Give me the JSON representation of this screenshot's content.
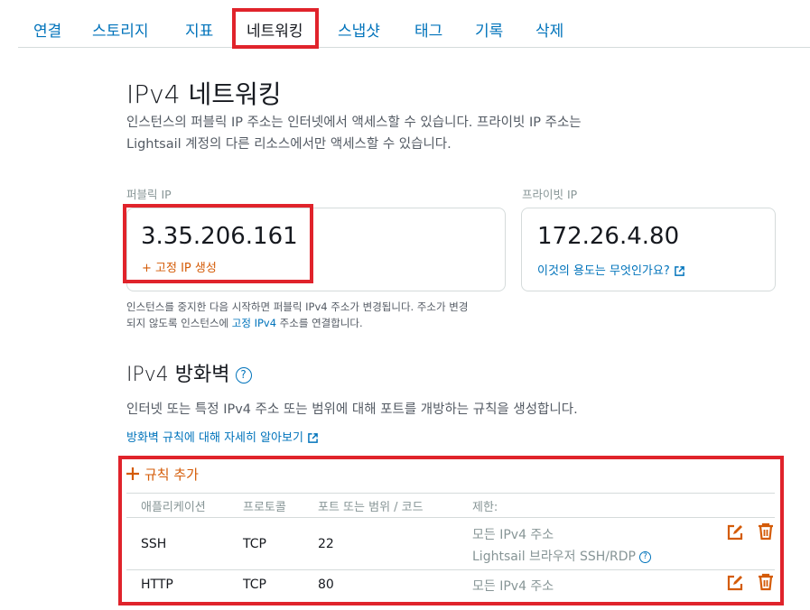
{
  "tabs": [
    "연결",
    "스토리지",
    "지표",
    "네트워킹",
    "스냅샷",
    "태그",
    "기록",
    "삭제"
  ],
  "active_tab": "네트워킹",
  "ipv4_networking": {
    "title_prefix": "IPv4",
    "title_rest": "네트워킹",
    "desc_line1": "인스턴스의 퍼블릭 IP 주소는 인터넷에서 액세스할 수 있습니다. 프라이빗 IP 주소는",
    "desc_line2": "Lightsail 계정의 다른 리소스에서만 액세스할 수 있습니다."
  },
  "public_ip": {
    "label": "퍼블릭 IP",
    "value": "3.35.206.161",
    "action": "+ 고정 IP 생성",
    "note_line1": "인스턴스를 중지한 다음 시작하면 퍼블릭 IPv4 주소가 변경됩니다. 주소가 변경",
    "note_line2_a": "되지 않도록 인스턴스에 ",
    "note_line2_link": "고정 IPv4",
    "note_line2_b": " 주소를 연결합니다."
  },
  "private_ip": {
    "label": "프라이빗 IP",
    "value": "172.26.4.80",
    "link": "이것의 용도는 무엇인가요?"
  },
  "firewall": {
    "title_prefix": "IPv4",
    "title_rest": "방화벽",
    "help": "?",
    "desc": "인터넷 또는 특정 IPv4 주소 또는 범위에 대해 포트를 개방하는 규칙을 생성합니다.",
    "learn_more": "방화벽 규칙에 대해 자세히 알아보기",
    "add_rule": "규칙 추가",
    "columns": [
      "애플리케이션",
      "프로토콜",
      "포트 또는 범위 / 코드",
      "제한:"
    ],
    "rules": [
      {
        "app": "SSH",
        "protocol": "TCP",
        "port": "22",
        "restriction": "모든 IPv4 주소",
        "restriction2": "Lightsail 브라우저 SSH/RDP"
      },
      {
        "app": "HTTP",
        "protocol": "TCP",
        "port": "80",
        "restriction": "모든 IPv4 주소",
        "restriction2": ""
      }
    ]
  },
  "colors": {
    "link": "#0073bb",
    "orange": "#d45b07",
    "highlight": "#e0232b",
    "muted": "#879596"
  }
}
